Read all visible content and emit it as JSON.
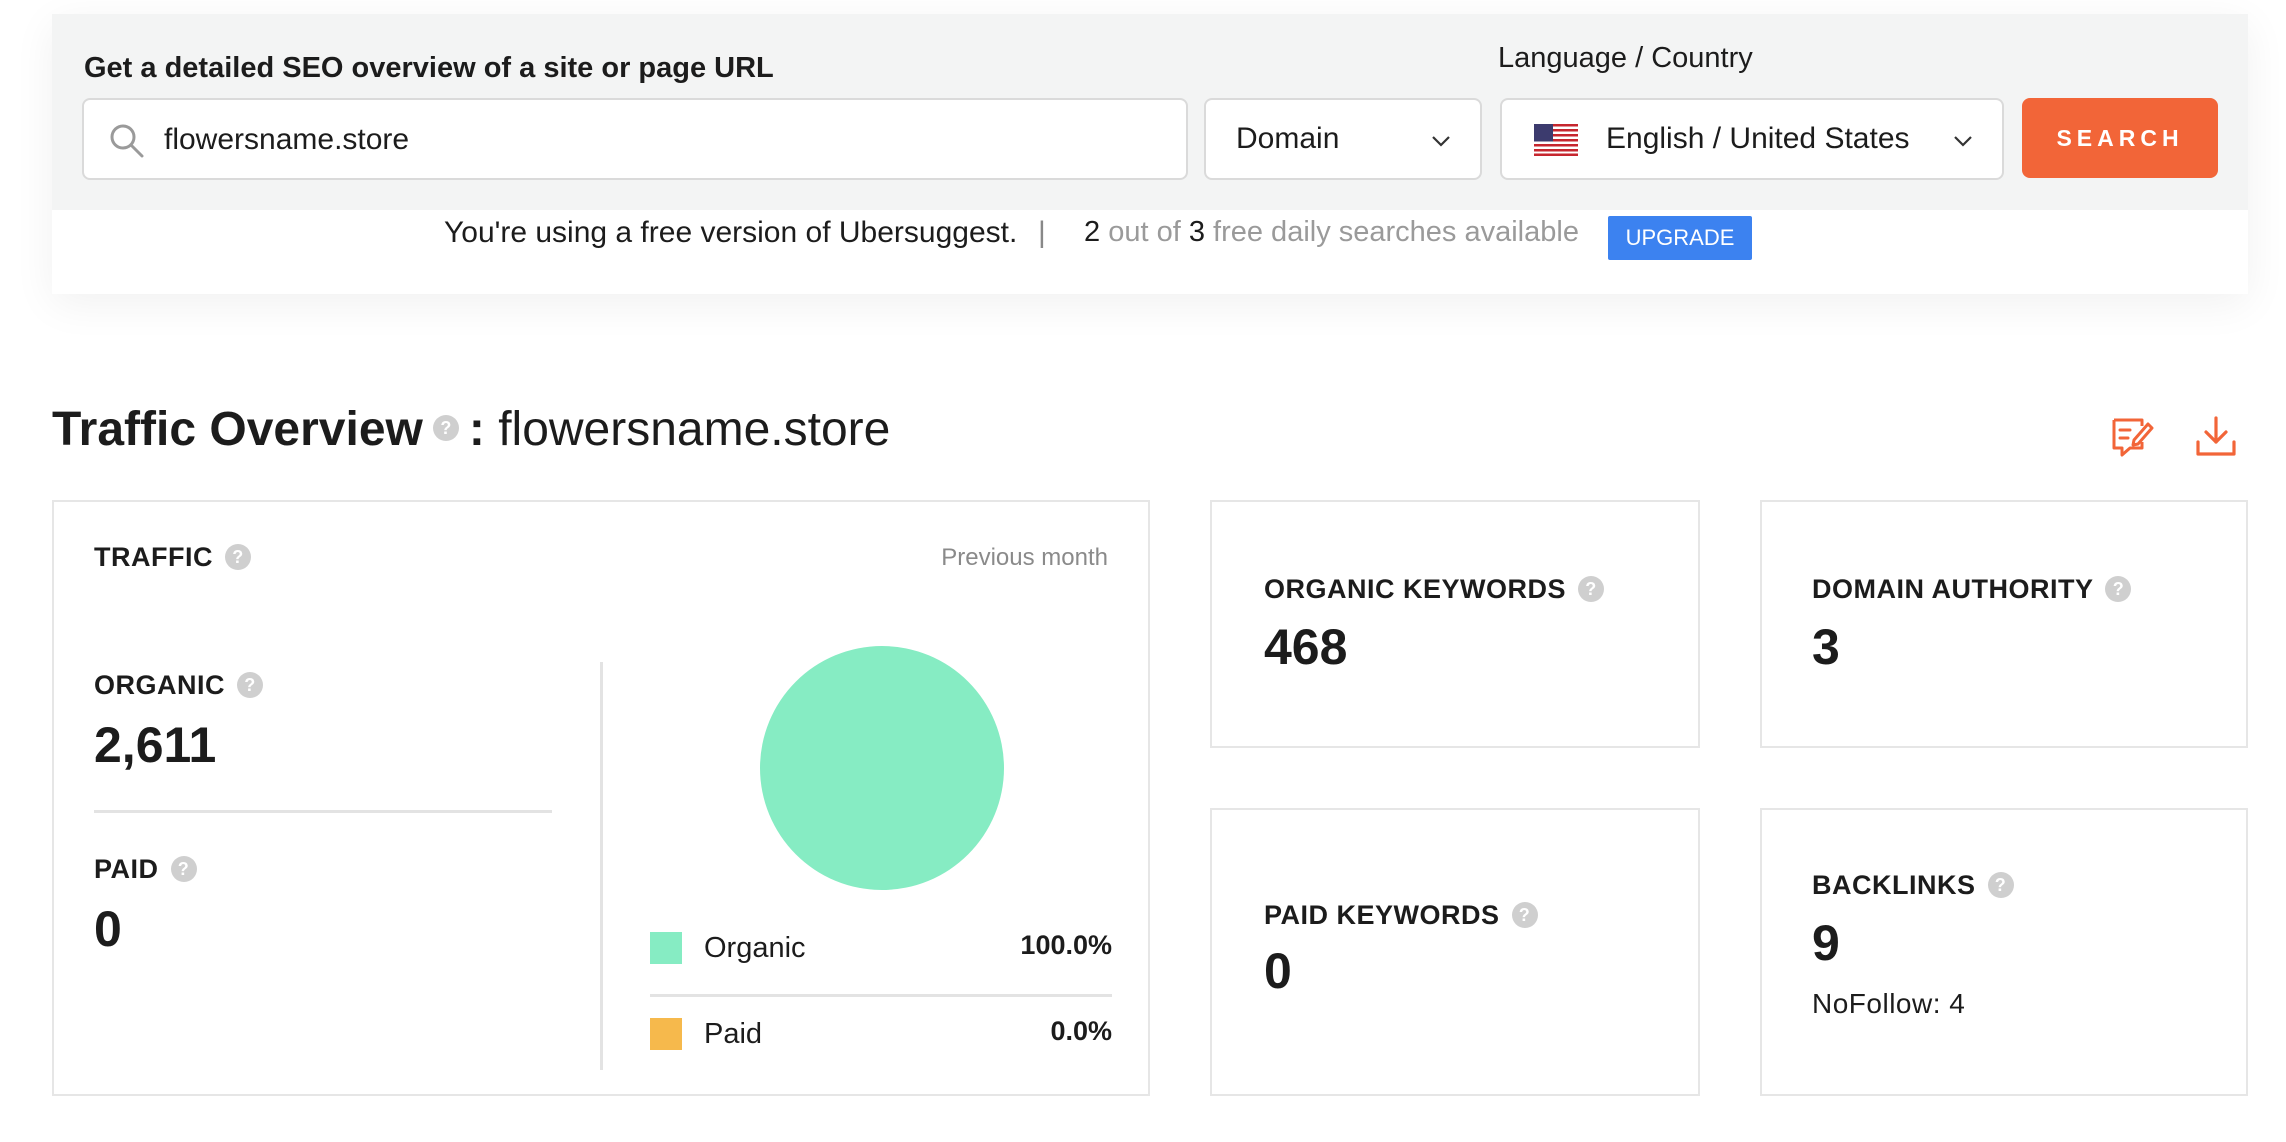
{
  "search": {
    "label": "Get a detailed SEO overview of a site or page URL",
    "value": "flowersname.store",
    "placeholder": "",
    "mode": "Domain",
    "language_label": "Language / Country",
    "language": "English / United States",
    "button": "SEARCH"
  },
  "free_notice": {
    "text": "You're using a free version of Ubersuggest.",
    "separator": "|",
    "used": "2",
    "out_of": "out of",
    "total": "3",
    "suffix": "free daily searches available",
    "upgrade": "UPGRADE"
  },
  "overview": {
    "title": "Traffic Overview",
    "help": "?",
    "colon": ":",
    "domain": "flowersname.store"
  },
  "traffic": {
    "label": "TRAFFIC",
    "period": "Previous month",
    "organic_label": "ORGANIC",
    "organic_value": "2,611",
    "paid_label": "PAID",
    "paid_value": "0",
    "legend": [
      {
        "label": "Organic",
        "value": "100.0%",
        "percent": 100.0,
        "color": "#86ecc3"
      },
      {
        "label": "Paid",
        "value": "0.0%",
        "percent": 0.0,
        "color": "#f6b94c"
      }
    ]
  },
  "metrics": {
    "organic_keywords_label": "ORGANIC KEYWORDS",
    "organic_keywords_value": "468",
    "domain_authority_label": "DOMAIN AUTHORITY",
    "domain_authority_value": "3",
    "paid_keywords_label": "PAID KEYWORDS",
    "paid_keywords_value": "0",
    "backlinks_label": "BACKLINKS",
    "backlinks_value": "9",
    "nofollow": "NoFollow: 4"
  },
  "colors": {
    "accent": "#f26538",
    "upgrade": "#3c82f0",
    "organic": "#86ecc3",
    "paid": "#f6b94c"
  },
  "icons": {
    "search": "search-icon",
    "chevron": "chevron-down-icon",
    "flag": "us-flag-icon",
    "report": "edit-report-icon",
    "download": "download-icon",
    "help": "help-icon"
  }
}
